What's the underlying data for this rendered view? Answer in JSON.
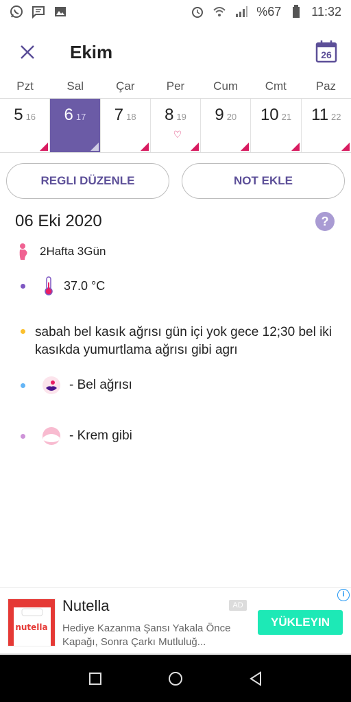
{
  "status_bar": {
    "battery_text": "%67",
    "time": "11:32",
    "left_icons": [
      "whatsapp-icon",
      "message-icon",
      "image-icon"
    ],
    "right_icons": [
      "alarm-icon",
      "wifi-icon",
      "signal-icon",
      "battery-icon"
    ]
  },
  "header": {
    "title": "Ekim",
    "calendar_day": "26"
  },
  "week": {
    "weekdays": [
      "Pzt",
      "Sal",
      "Çar",
      "Per",
      "Cum",
      "Cmt",
      "Paz"
    ],
    "days": [
      {
        "day": "5",
        "sub": "16"
      },
      {
        "day": "6",
        "sub": "17",
        "selected": true
      },
      {
        "day": "7",
        "sub": "18"
      },
      {
        "day": "8",
        "sub": "19",
        "heart": true
      },
      {
        "day": "9",
        "sub": "20"
      },
      {
        "day": "10",
        "sub": "21"
      },
      {
        "day": "11",
        "sub": "22"
      }
    ],
    "heart_symbol": "♡"
  },
  "actions": {
    "edit_period": "REGLI DÜZENLE",
    "add_note": "NOT EKLE"
  },
  "detail": {
    "date": "06 Eki 2020",
    "help": "?",
    "pregnancy": "2Hafta 3Gün",
    "temperature": "37.0 °C",
    "note": "sabah bel kasık ağrısı gün içi yok gece 12;30 bel iki kasıkda yumurtlama ağrısı gibi agrı",
    "symptom": "-  Bel ağrısı",
    "discharge": "-  Krem gibi"
  },
  "colors": {
    "accent": "#5c4f98",
    "selected_day": "#6b5ba6",
    "period_marker": "#d81b60",
    "temp_dot": "#7e57c2",
    "note_dot": "#fbc02d",
    "symptom_dot": "#64b5f6",
    "discharge_dot": "#ce93d8"
  },
  "ad": {
    "title": "Nutella",
    "badge": "AD",
    "description": "Hediye Kazanma Şansı Yakala Önce Kapağı, Sonra Çarkı Mutluluğ...",
    "cta": "YÜKLEYIN",
    "image_label": "nutella",
    "info": "i"
  }
}
